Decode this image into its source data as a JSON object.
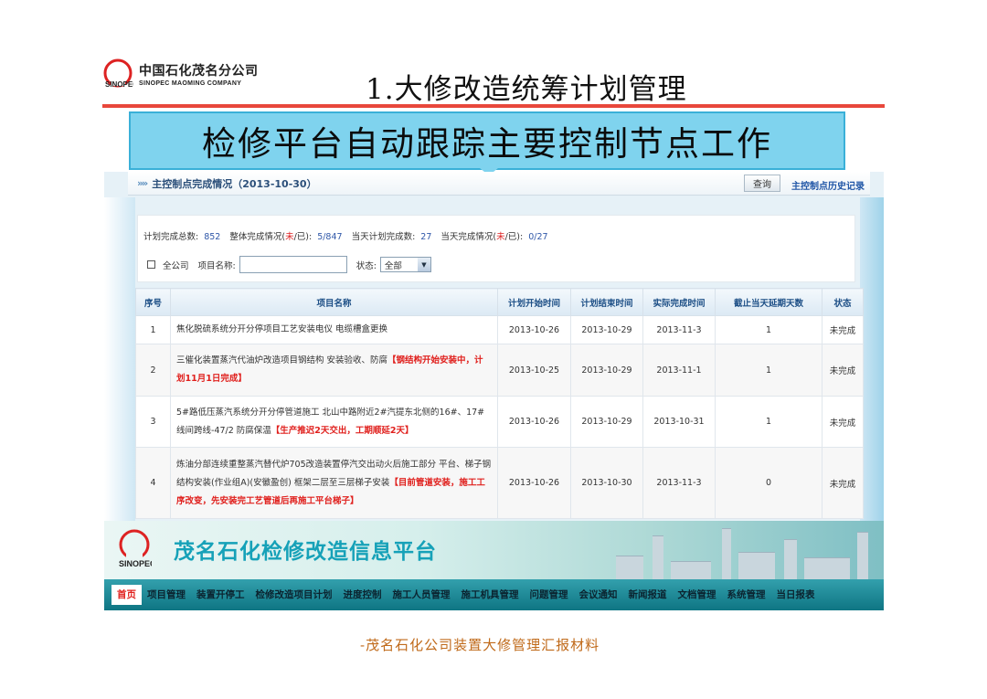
{
  "slide": {
    "company_cn": "中国石化茂名分公司",
    "company_en": "SINOPEC MAOMING COMPANY",
    "title": "1.大修改造统筹计划管理",
    "banner": "检修平台自动跟踪主要控制节点工作",
    "caption": "-茂名石化公司装置大修管理汇报材料"
  },
  "panel": {
    "head_title": "主控制点完成情况（2013-10-30）",
    "query_label": "查询",
    "history_link": "主控制点历史记录"
  },
  "stats": {
    "total_label": "计划完成总数:",
    "total_value": "852",
    "overall_label_a": "整体完成情况(",
    "overall_label_red": "未",
    "overall_label_b": "/已):",
    "overall_value": "5/847",
    "today_plan_label": "当天计划完成数:",
    "today_plan_value": "27",
    "today_label_a": "当天完成情况(",
    "today_label_red": "未",
    "today_label_b": "/已):",
    "today_value": "0/27"
  },
  "filters": {
    "all_company_label": "全公司",
    "project_name_label": "项目名称:",
    "project_name_value": "",
    "status_label": "状态:",
    "status_value": "全部"
  },
  "table": {
    "headers": [
      "序号",
      "项目名称",
      "计划开始时间",
      "计划结束时间",
      "实际完成时间",
      "截止当天延期天数",
      "状态"
    ],
    "rows": [
      {
        "no": "1",
        "name": "焦化脱硫系统分开分停项目工艺安装电仪 电缆槽盒更换",
        "highlight": "",
        "start": "2013-10-26",
        "end": "2013-10-29",
        "done": "2013-11-3",
        "delay": "1",
        "status": "未完成"
      },
      {
        "no": "2",
        "name": "三催化装置蒸汽代油炉改造项目钢结构 安装验收、防腐",
        "highlight": "【钢结构开始安装中，计划11月1日完成】",
        "start": "2013-10-25",
        "end": "2013-10-29",
        "done": "2013-11-1",
        "delay": "1",
        "status": "未完成"
      },
      {
        "no": "3",
        "name": "5#路低压蒸汽系统分开分停管道施工 北山中路附近2#汽提东北侧的16#、17#线间跨线-47/2 防腐保温",
        "highlight": "【生产推迟2天交出，工期顺延2天】",
        "start": "2013-10-26",
        "end": "2013-10-29",
        "done": "2013-10-31",
        "delay": "1",
        "status": "未完成"
      },
      {
        "no": "4",
        "name": "炼油分部连续重整蒸汽替代炉705改造装置停汽交出动火后施工部分 平台、梯子钢结构安装(作业组A)(安徽盈创) 框架二层至三层梯子安装",
        "highlight": "【目前管道安装，施工工序改变，先安装完工艺管道后再施工平台梯子】",
        "start": "2013-10-26",
        "end": "2013-10-30",
        "done": "2013-11-3",
        "delay": "0",
        "status": "未完成"
      }
    ]
  },
  "platform": {
    "name": "茂名石化检修改造信息平台",
    "nav": [
      "首页",
      "项目管理",
      "装置开停工",
      "检修改造项目计划",
      "进度控制",
      "施工人员管理",
      "施工机具管理",
      "问题管理",
      "会议通知",
      "新闻报道",
      "文档管理",
      "系统管理",
      "当日报表"
    ]
  },
  "colors": {
    "title_rule": "#e8473b",
    "banner_bg": "#7fd3ee",
    "highlight_red": "#e0201d",
    "nav_bar": "#1a8995",
    "caption": "#c06a1a"
  }
}
